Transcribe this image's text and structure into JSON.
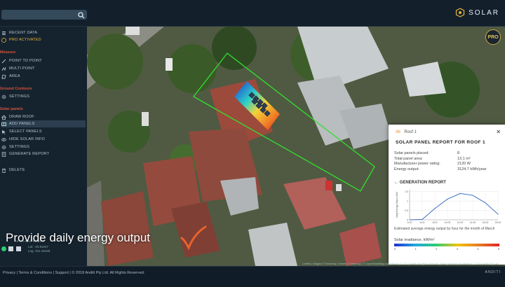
{
  "brand": {
    "name": "SOLAR"
  },
  "search": {
    "placeholder": ""
  },
  "sidebar": {
    "top_items": [
      {
        "label": "RECENT DATA",
        "icon": "menu-icon"
      },
      {
        "label": "PRO ACTIVATED",
        "icon": "pro-badge-icon"
      }
    ],
    "measure": {
      "title": "Measure",
      "items": [
        {
          "label": "POINT TO POINT",
          "icon": "ruler-icon"
        },
        {
          "label": "MULTI POINT",
          "icon": "polyline-icon"
        },
        {
          "label": "AREA",
          "icon": "area-icon"
        }
      ]
    },
    "ground": {
      "title": "Ground Contours",
      "items": [
        {
          "label": "SETTINGS",
          "icon": "gear-icon"
        }
      ]
    },
    "solar": {
      "title": "Solar panels",
      "items": [
        {
          "label": "DRAW ROOF",
          "icon": "roof-icon"
        },
        {
          "label": "ADD PANELS",
          "icon": "panel-icon",
          "active": true
        },
        {
          "label": "SELECT PANELS",
          "icon": "select-icon"
        },
        {
          "label": "HIDE SOLAR INFO",
          "icon": "eye-icon"
        },
        {
          "label": "SETTINGS",
          "icon": "gear-icon"
        },
        {
          "label": "GENERATE REPORT",
          "icon": "report-icon"
        }
      ]
    },
    "delete": {
      "label": "DELETE",
      "icon": "trash-icon"
    },
    "geo": {
      "date": "Hi-res date: 1/2/2017",
      "lat": "Lat:  -33.91047",
      "lng": "Lng:  151.16429",
      "scale": "N"
    }
  },
  "map": {
    "pro_badge": "PRO"
  },
  "report": {
    "tab_all": "All",
    "tab_roof": "Roof 1",
    "title": "SOLAR PANEL REPORT FOR ROOF 1",
    "rows": [
      {
        "k": "Solar panels placed:",
        "v": "8"
      },
      {
        "k": "Total panel area:",
        "v": "13.1 m²"
      },
      {
        "k": "Manufacturer power rating:",
        "v": "2120 W"
      },
      {
        "k": "Energy output:",
        "v": "3124.7 kWh/year"
      }
    ],
    "generation_button": "GENERATION REPORT",
    "caption": "Estimated average energy output by hour for the month of March",
    "irradiance_label": "Solar irradiance, kW/m²",
    "irradiance_ticks": [
      "0",
      "1",
      "2",
      "3",
      "4",
      "5"
    ]
  },
  "chart_data": {
    "type": "line",
    "title": "",
    "xlabel": "",
    "ylabel": "Daily Energy Output, kWh",
    "x": [
      "4:00",
      "6:00",
      "8:00",
      "10:00",
      "12:00",
      "14:00",
      "16:00",
      "18:00"
    ],
    "series": [
      {
        "values": [
          0,
          0.02,
          0.6,
          1.1,
          1.4,
          1.3,
          0.9,
          0.3
        ]
      }
    ],
    "y_ticks": [
      "0",
      "0.5",
      "1",
      "1.5"
    ],
    "ylim": [
      0,
      1.6
    ],
    "grid": true
  },
  "overlay": {
    "caption": "Provide daily energy output"
  },
  "footer": {
    "links": "Privacy  |  Terms & Conditions  |  Support  |  © 2018 Anditi Pty Ltd. All Rights Reserved.",
    "logo": "ANDITI"
  },
  "attribution": "Leaflet | Imagery © Nearmap, Streets © Nearmap | © OpenStreetMap contributors © 2017 Anditi. All rights reserved. Solar potential visualisation © 2018 Anditi Pty Ltd"
}
